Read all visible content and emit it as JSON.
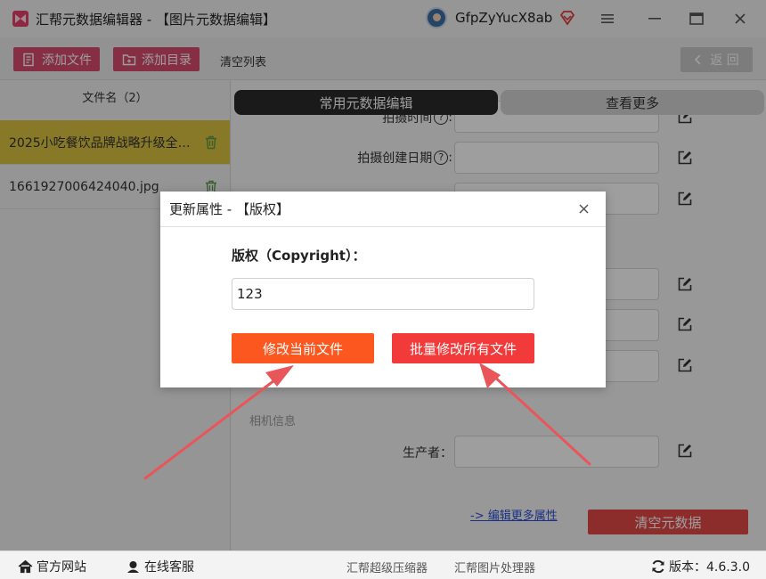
{
  "window": {
    "title": "汇帮元数据编辑器 - 【图片元数据编辑】",
    "username": "GfpZyYucX8ab"
  },
  "toolbar": {
    "add_file": "添加文件",
    "add_dir": "添加目录",
    "clear_list": "清空列表",
    "back": "返 回"
  },
  "sidebar": {
    "header": "文件名（2）",
    "files": [
      {
        "name": "2025小吃餐饮品牌战略升级全案..."
      },
      {
        "name": "1661927006424040.jpg"
      }
    ]
  },
  "main": {
    "tabs": [
      "常用元数据编辑",
      "查看更多"
    ],
    "rows": [
      {
        "label": "拍摄时间"
      },
      {
        "label": "拍摄创建日期"
      },
      {
        "label": "生产者："
      }
    ],
    "section_camera": "相机信息",
    "more_link": "-> 编辑更多属性",
    "clear_button": "清空元数据"
  },
  "dialog": {
    "title": "更新属性 - 【版权】",
    "field_label": "版权（Copyright）：",
    "field_value": "123",
    "btn_current": "修改当前文件",
    "btn_all": "批量修改所有文件"
  },
  "footer": {
    "website": "官方网站",
    "service": "在线客服",
    "compressor": "汇帮超级压缩器",
    "image_tool": "汇帮图片处理器",
    "version": "版本：4.6.3.0"
  },
  "colors": {
    "toolbar_button": "#d94b6e",
    "active_file": "#dbc441",
    "btn_current": "#fd5720",
    "btn_all": "#f23a3a",
    "arrow": "#e8565a"
  }
}
